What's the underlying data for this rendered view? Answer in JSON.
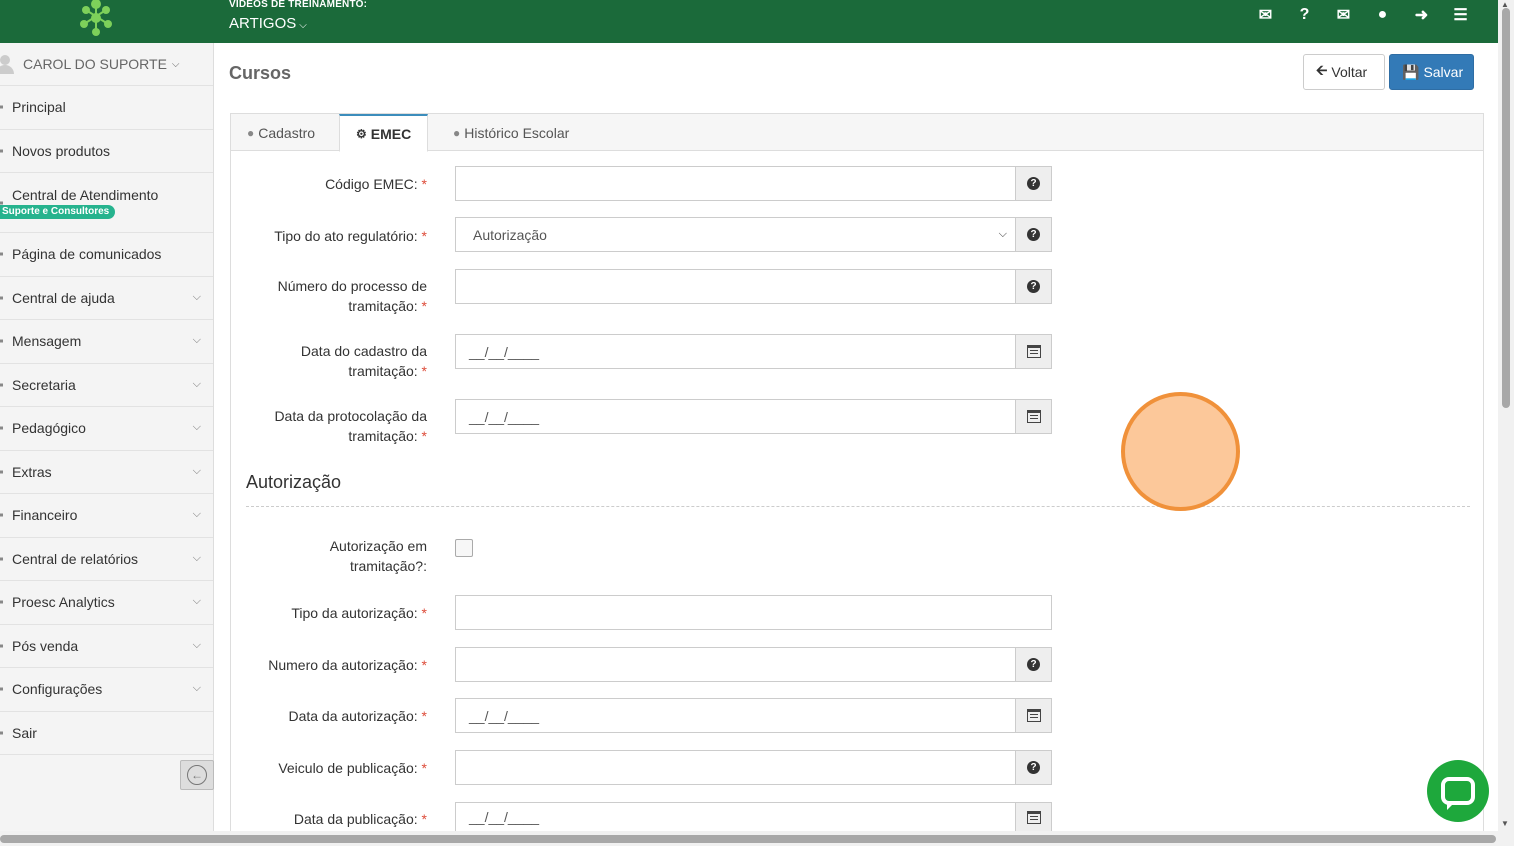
{
  "header": {
    "subtitle": "VÍDEOS DE TREINAMENTO:",
    "section": "ARTIGOS",
    "icons": [
      "handshake-icon",
      "question-icon",
      "envelope-icon",
      "user-icon",
      "sign-out-icon",
      "menu-icon"
    ]
  },
  "sidebar": {
    "user": "CAROL DO SUPORTE",
    "items": [
      {
        "label": "Principal"
      },
      {
        "label": "Novos produtos"
      },
      {
        "label": "Central de Atendimento",
        "badge": "Suporte e Consultores"
      },
      {
        "label": "Página de comunicados"
      },
      {
        "label": "Central de ajuda"
      },
      {
        "label": "Mensagem"
      },
      {
        "label": "Secretaria"
      },
      {
        "label": "Pedagógico"
      },
      {
        "label": "Extras"
      },
      {
        "label": "Financeiro"
      },
      {
        "label": "Central de relatórios"
      },
      {
        "label": "Proesc Analytics"
      },
      {
        "label": "Pós venda"
      },
      {
        "label": "Configurações"
      },
      {
        "label": "Sair"
      }
    ]
  },
  "main": {
    "title": "Cursos",
    "back_label": "Voltar",
    "save_label": "Salvar",
    "tabs": [
      {
        "label": "Cadastro"
      },
      {
        "label": "EMEC"
      },
      {
        "label": "Histórico Escolar"
      }
    ],
    "form": {
      "codigo_emec": {
        "label": "Código EMEC:",
        "value": ""
      },
      "tipo_ato": {
        "label": "Tipo do ato regulatório:",
        "value": "Autorização"
      },
      "numero_processo": {
        "label_1": "Número do processo de",
        "label_2": "tramitação:",
        "value": ""
      },
      "data_cadastro": {
        "label_1": "Data do cadastro da",
        "label_2": "tramitação:",
        "placeholder": "__/__/____"
      },
      "data_protocolacao": {
        "label_1": "Data da protocolação da",
        "label_2": "tramitação:",
        "placeholder": "__/__/____"
      },
      "section_title": "Autorização",
      "autorizacao_tramitacao": {
        "label_1": "Autorização em",
        "label_2": "tramitação?:",
        "checked": false
      },
      "tipo_autorizacao": {
        "label": "Tipo da autorização:",
        "value": ""
      },
      "numero_autorizacao": {
        "label": "Numero da autorização:",
        "value": ""
      },
      "data_autorizacao": {
        "label": "Data da autorização:",
        "placeholder": "__/__/____"
      },
      "veiculo_publicacao": {
        "label": "Veiculo de publicação:",
        "value": ""
      },
      "data_publicacao": {
        "label": "Data da publicação:",
        "placeholder": "__/__/____"
      }
    },
    "required_mark": "*"
  },
  "colors": {
    "topbar": "#1b6a3a",
    "primary": "#337ab7",
    "badge": "#26b38e",
    "chat": "#1ea83c",
    "cursor": "#f0913a"
  }
}
